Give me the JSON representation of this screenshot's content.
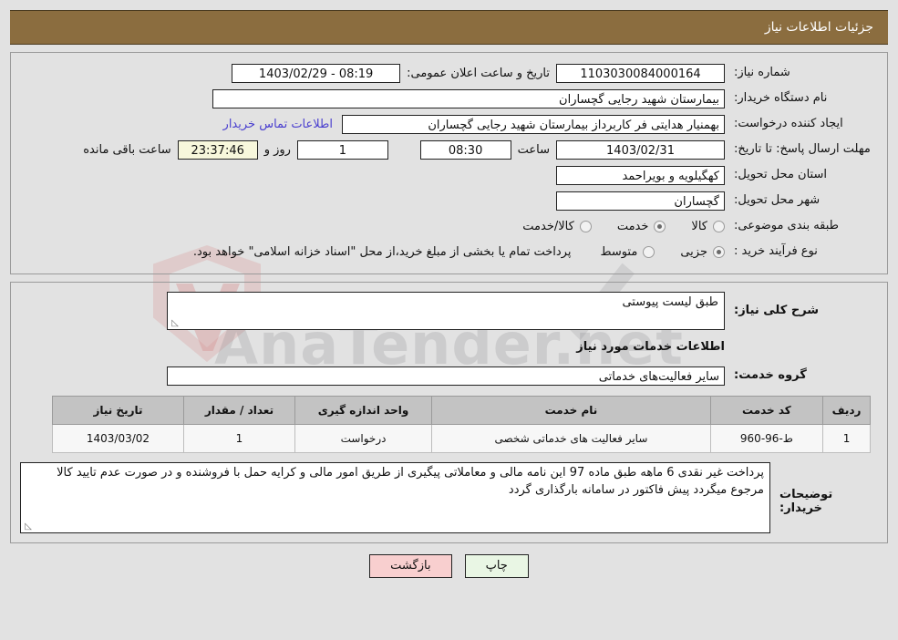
{
  "header": {
    "title": "جزئیات اطلاعات نیاز"
  },
  "watermark": {
    "text": "AnaTender.net"
  },
  "form": {
    "need_number": {
      "label": "شماره نیاز:",
      "value": "1103030084000164"
    },
    "announce_datetime": {
      "label": "تاریخ و ساعت اعلان عمومی:",
      "value": "08:19 - 1403/02/29"
    },
    "buyer_org": {
      "label": "نام دستگاه خریدار:",
      "value": "بیمارستان شهید رجایی گچساران"
    },
    "request_creator": {
      "label": "ایجاد کننده درخواست:",
      "value": "بهمنیار هدایتی فر کاربرداز بیمارستان شهید رجایی گچساران"
    },
    "buyer_contact_link": "اطلاعات تماس خریدار",
    "deadline": {
      "label": "مهلت ارسال پاسخ: تا تاریخ:",
      "date": "1403/02/31",
      "time_label": "ساعت",
      "time": "08:30",
      "days": "1",
      "days_label": "روز و",
      "remaining": "23:37:46",
      "remaining_label": "ساعت باقی مانده"
    },
    "delivery_province": {
      "label": "استان محل تحویل:",
      "value": "کهگیلویه و بویراحمد"
    },
    "delivery_city": {
      "label": "شهر محل تحویل:",
      "value": "گچساران"
    },
    "subject_category": {
      "label": "طبقه بندی موضوعی:",
      "options": [
        "کالا",
        "خدمت",
        "کالا/خدمت"
      ],
      "selected": "خدمت"
    },
    "purchase_process": {
      "label": "نوع فرآیند خرید :",
      "options": [
        "جزیی",
        "متوسط"
      ],
      "selected": "جزیی",
      "note": "پرداخت تمام یا بخشی از مبلغ خرید،از محل \"اسناد خزانه اسلامی\" خواهد بود."
    }
  },
  "details": {
    "general_desc": {
      "label": "شرح کلی نیاز:",
      "value": "طبق لیست پیوستی"
    },
    "services_section_title": "اطلاعات خدمات مورد نیاز",
    "service_group": {
      "label": "گروه خدمت:",
      "value": "سایر فعالیت‌های خدماتی"
    },
    "table": {
      "columns": [
        "ردیف",
        "کد خدمت",
        "نام خدمت",
        "واحد اندازه گیری",
        "تعداد / مقدار",
        "تاریخ نیاز"
      ],
      "rows": [
        {
          "radif": "1",
          "code": "ط-96-960",
          "name": "سایر فعالیت های خدماتی شخصی",
          "unit": "درخواست",
          "qty": "1",
          "date": "1403/03/02"
        }
      ]
    },
    "buyer_notes": {
      "label": "توضیحات خریدار:",
      "value": "پرداخت غیر نقدی 6 ماهه  طبق ماده 97 این نامه مالی و معاملاتی پیگیری از طریق امور مالی  و کرایه حمل با فروشنده و در صورت عدم تایید کالا مرجوع میگردد پیش فاکتور در سامانه بارگذاری گردد"
    }
  },
  "buttons": {
    "print": "چاپ",
    "back": "بازگشت"
  },
  "colors": {
    "header_bg": "#8b6d3f",
    "page_bg": "#e2e2e2",
    "link": "#4a3fcf",
    "print_btn": "#e9f6e4",
    "back_btn": "#f8cfcf",
    "countdown_bg": "#f7f7dc"
  }
}
